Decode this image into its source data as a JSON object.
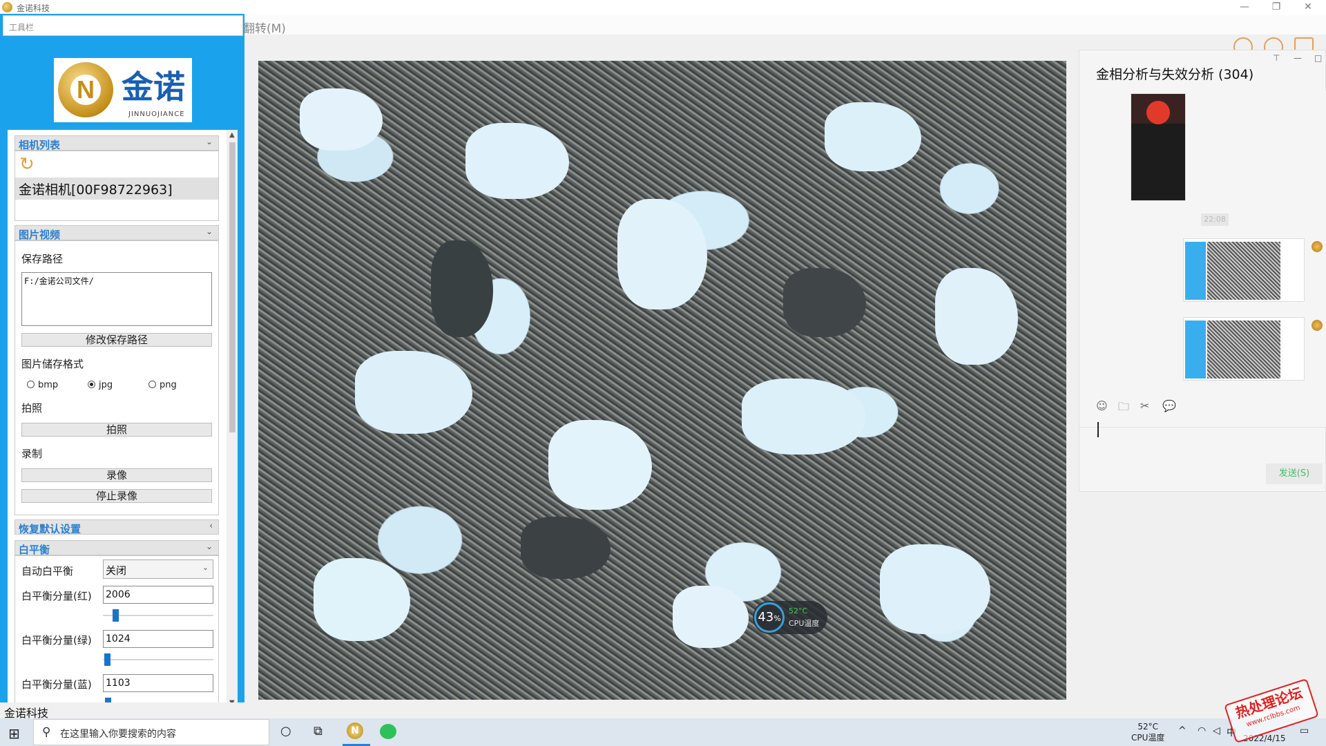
{
  "window": {
    "title": "金诺科技",
    "menu_flip": "翻转(M)",
    "min": "—",
    "restore": "❐",
    "close": "✕"
  },
  "toolbar": {
    "header": "工具栏",
    "brand": {
      "glyph": "N",
      "name": "金诺",
      "sub": "JINNUOJIANCE"
    },
    "sections": {
      "camera_list": "相机列表",
      "picture_video": "图片视频",
      "restore_defaults": "恢复默认设置",
      "white_balance": "白平衡"
    },
    "camera": {
      "refresh_icon": "↻",
      "item": "金诺相机[00F98722963]"
    },
    "save_path": {
      "label": "保存路径",
      "value": "F:/金诺公司文件/",
      "change_button": "修改保存路径"
    },
    "format": {
      "label": "图片储存格式",
      "options": [
        "bmp",
        "jpg",
        "png"
      ],
      "selected": "jpg"
    },
    "capture": {
      "label": "拍照",
      "button": "拍照"
    },
    "record": {
      "label": "录制",
      "start_button": "录像",
      "stop_button": "停止录像"
    },
    "white_balance": {
      "auto_label": "自动白平衡",
      "auto_value": "关闭",
      "red_label": "白平衡分量(红)",
      "red_value": "2006",
      "green_label": "白平衡分量(绿)",
      "green_value": "1024",
      "blue_label": "白平衡分量(蓝)",
      "blue_value": "1103"
    }
  },
  "cpu_widget": {
    "percent": "43",
    "percent_unit": "%",
    "temp": "52°C",
    "label": "CPU温度"
  },
  "chat": {
    "title": "金相分析与失效分析 (304)",
    "time": "22:08",
    "send_button": "发送(S)",
    "tool_icons": [
      "☺",
      "🗀",
      "✂",
      "💬"
    ],
    "pin": "⊤",
    "min": "—",
    "max": "□"
  },
  "statusbar": {
    "text": "金诺科技"
  },
  "taskbar": {
    "start_icon": "⊞",
    "search_icon": "⚲",
    "search_placeholder": "在这里输入你要搜索的内容",
    "cortana_icon": "○",
    "taskview_icon": "⧉",
    "app_glyph": "N",
    "tray_temp": "52°C",
    "tray_temp_label": "CPU温度",
    "tray_up": "^",
    "tray_ime": "中",
    "tray_date": "2022/4/15",
    "notification_icon": "▭"
  },
  "watermark": {
    "text": "热处理论坛",
    "sub": "www.rclbbs.com"
  }
}
